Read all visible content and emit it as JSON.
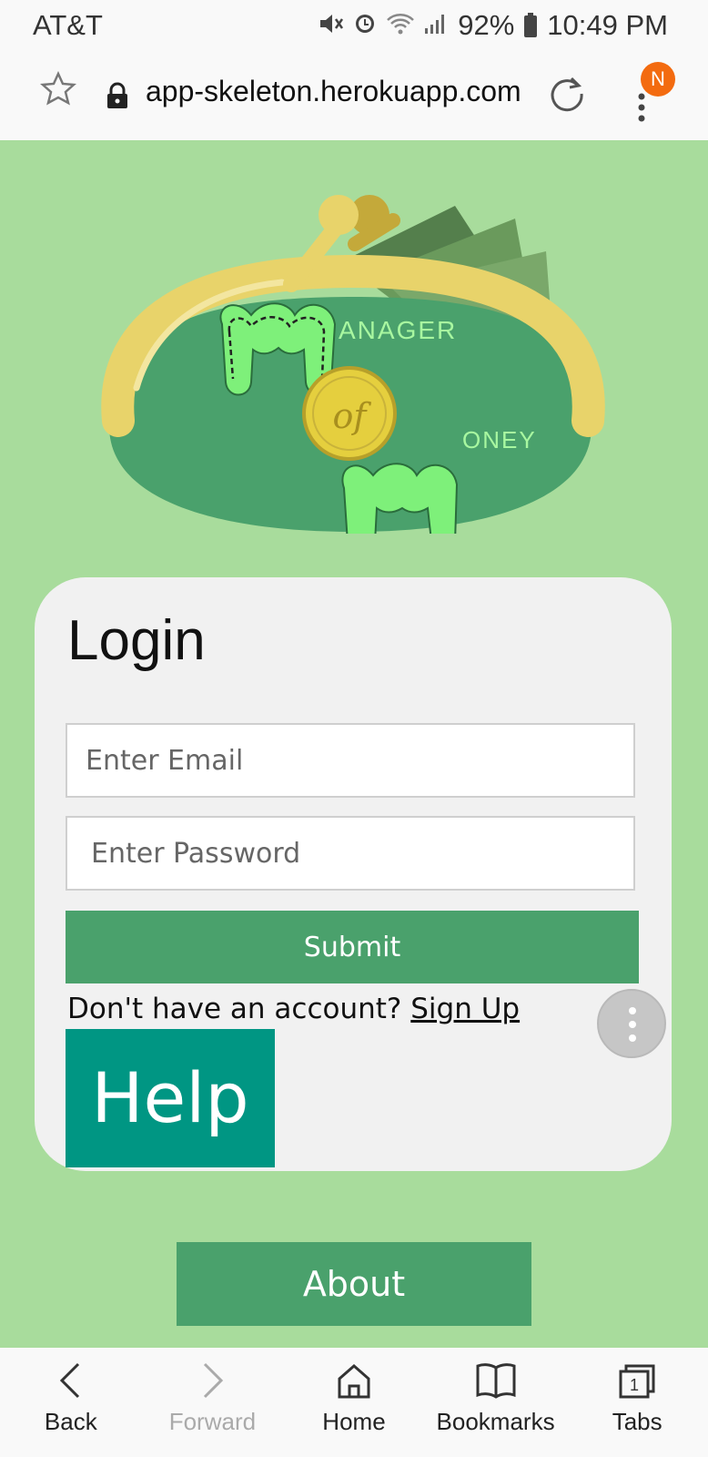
{
  "status_bar": {
    "carrier": "AT&T",
    "battery_percent": "92%",
    "time": "10:49 PM",
    "icons": [
      "mute-icon",
      "alarm-icon",
      "wifi-icon",
      "signal-icon",
      "battery-icon"
    ]
  },
  "browser": {
    "url": "app-skeleton.herokuapp.com",
    "avatar_letter": "N",
    "icons": [
      "star-icon",
      "lock-icon",
      "reload-icon",
      "menu-icon"
    ]
  },
  "logo": {
    "text_manager": "ANAGER",
    "text_of": "of",
    "text_money": "ONEY"
  },
  "login": {
    "title": "Login",
    "email_placeholder": "Enter Email",
    "password_placeholder": "Enter Password",
    "submit_label": "Submit",
    "no_account_text": "Don't have an account?",
    "signup_link": "Sign Up",
    "help_label": "Help"
  },
  "about_label": "About",
  "bottom_nav": {
    "back": "Back",
    "forward": "Forward",
    "home": "Home",
    "bookmarks": "Bookmarks",
    "tabs": "Tabs",
    "tabs_count": "1"
  },
  "colors": {
    "page_background": "#a8dc9c",
    "primary_green": "#4aa16c",
    "help_teal": "#009683",
    "card_background": "#f1f1f1",
    "avatar_orange": "#f36b10"
  }
}
